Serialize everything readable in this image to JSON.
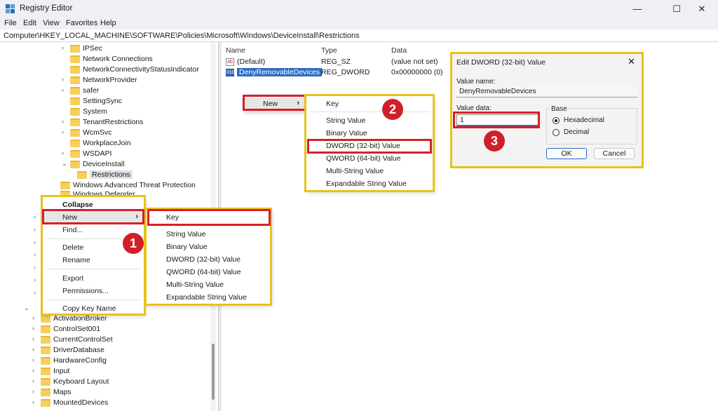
{
  "window": {
    "title": "Registry Editor",
    "minimize": "—",
    "maximize": "☐",
    "close": "✕"
  },
  "menubar": [
    "File",
    "Edit",
    "View",
    "Favorites",
    "Help"
  ],
  "address": "Computer\\HKEY_LOCAL_MACHINE\\SOFTWARE\\Policies\\Microsoft\\Windows\\DeviceInstall\\Restrictions",
  "tree": {
    "upper": [
      {
        "label": "IPSec",
        "chev": "›"
      },
      {
        "label": "Network Connections",
        "chev": ""
      },
      {
        "label": "NetworkConnectivityStatusIndicator",
        "chev": ""
      },
      {
        "label": "NetworkProvider",
        "chev": "›"
      },
      {
        "label": "safer",
        "chev": "›"
      },
      {
        "label": "SettingSync",
        "chev": ""
      },
      {
        "label": "System",
        "chev": ""
      },
      {
        "label": "TenantRestrictions",
        "chev": "›"
      },
      {
        "label": "WcmSvc",
        "chev": "›"
      },
      {
        "label": "WorkplaceJoin",
        "chev": ""
      },
      {
        "label": "WSDAPI",
        "chev": "›"
      },
      {
        "label": "DeviceInstall",
        "chev": "⌄"
      },
      {
        "label": "Restrictions",
        "chev": ""
      },
      {
        "label": "Windows Advanced Threat Protection",
        "chev": ""
      },
      {
        "label": "Windows Defender",
        "chev": ""
      }
    ],
    "lower": [
      {
        "label": "ActivationBroker",
        "chev": "›"
      },
      {
        "label": "ControlSet001",
        "chev": "›"
      },
      {
        "label": "CurrentControlSet",
        "chev": "›"
      },
      {
        "label": "DriverDatabase",
        "chev": "›"
      },
      {
        "label": "HardwareConfig",
        "chev": "›"
      },
      {
        "label": "Input",
        "chev": "›"
      },
      {
        "label": "Keyboard Layout",
        "chev": "›"
      },
      {
        "label": "Maps",
        "chev": "›"
      },
      {
        "label": "MountedDevices",
        "chev": "›"
      }
    ],
    "collapsed_chev": "⌄"
  },
  "list": {
    "columns": [
      "Name",
      "Type",
      "Data"
    ],
    "rows": [
      {
        "icon": "ab",
        "name": "(Default)",
        "type": "REG_SZ",
        "data": "(value not set)"
      },
      {
        "icon": "010",
        "name": "DenyRemovableDevices",
        "type": "REG_DWORD",
        "data": "0x00000000 (0)"
      }
    ]
  },
  "context_menu_1": {
    "items": [
      "Collapse",
      "New",
      "Find...",
      "Delete",
      "Rename",
      "Export",
      "Permissions...",
      "Copy Key Name"
    ],
    "arrow": "›"
  },
  "submenu_1": {
    "items": [
      "Key",
      "String Value",
      "Binary Value",
      "DWORD (32-bit) Value",
      "QWORD (64-bit) Value",
      "Multi-String Value",
      "Expandable String Value"
    ]
  },
  "context_menu_2": {
    "new_label": "New",
    "arrow": "›"
  },
  "submenu_2": {
    "items": [
      "Key",
      "String Value",
      "Binary Value",
      "DWORD (32-bit) Value",
      "QWORD (64-bit) Value",
      "Multi-String Value",
      "Expandable String Value"
    ]
  },
  "dialog": {
    "title": "Edit DWORD (32-bit) Value",
    "close": "✕",
    "value_name_label": "Value name:",
    "value_name": "DenyRemovableDevices",
    "value_data_label": "Value data:",
    "value_data": "1",
    "base_label": "Base",
    "hex_label": "Hexadecimal",
    "dec_label": "Decimal",
    "ok": "OK",
    "cancel": "Cancel"
  },
  "badges": [
    "1",
    "2",
    "3"
  ],
  "colors": {
    "highlight_yellow": "#e8c31a",
    "highlight_red": "#d51f27",
    "badge": "#d11f28",
    "selection": "#2b6cc4"
  }
}
